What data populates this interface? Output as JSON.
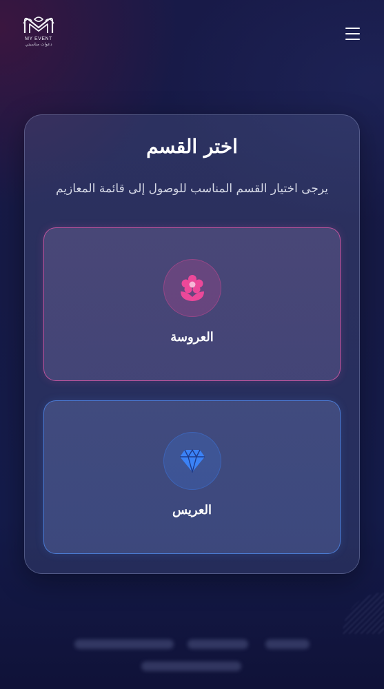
{
  "header": {
    "logo_text_en": "MY EVENT",
    "logo_text_ar": "دعوات مناسبتي",
    "menu_icon": "hamburger-icon"
  },
  "card": {
    "title": "اختر القسم",
    "subtitle": "يرجى اختيار القسم المناسب للوصول إلى قائمة المعازيم",
    "options": [
      {
        "label": "العروسة",
        "icon": "flower-icon",
        "accent": "#ec4899"
      },
      {
        "label": "العريس",
        "icon": "diamond-icon",
        "accent": "#3b82f6"
      }
    ]
  }
}
